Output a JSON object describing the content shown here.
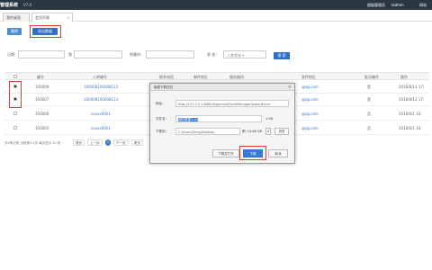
{
  "topbar": {
    "title": "管理系统",
    "version": "V7.0",
    "user1": "超级管理员",
    "user2": "ladmin",
    "user3": "网站"
  },
  "tabs": [
    {
      "label": "我的桌面"
    },
    {
      "label": "会员列表"
    }
  ],
  "toolbar": {
    "delete_label": "删除",
    "export_label": "导出数据"
  },
  "filter": {
    "label_date": "日期：",
    "label_to": "到",
    "label_city": "所属市：",
    "label_status": "状 态：",
    "status_value": "入库状态",
    "search_label": "搜 索"
  },
  "table": {
    "headers": [
      "编号",
      "入库编号",
      "联系电话",
      "邮件地址",
      "服务器码",
      "发件地址",
      "批次编号",
      "操作"
    ],
    "rows": [
      {
        "id": "100008",
        "code": "100008100008123",
        "email": "@qq.com",
        "op": "是",
        "date": "2016/8/12 17:"
      },
      {
        "id": "100007",
        "code": "100008100008123",
        "email": "@qq.com",
        "op": "是",
        "date": "2016/8/12 17:"
      },
      {
        "id": "100006",
        "code": "xxxxx0001",
        "email": "@qq.com",
        "op": "否",
        "date": "2016/6/1 10:"
      },
      {
        "id": "100005",
        "code": "xxxxx0001",
        "email": "@qq.com",
        "op": "否",
        "date": "2016/6/1 10:"
      }
    ]
  },
  "pager": {
    "info": "共4条记录 当前第1/1页 每页显示 10 条",
    "first": "首页",
    "prev": "上一页",
    "current": "1",
    "next": "下一页",
    "last": "尾页"
  },
  "dialog": {
    "title": "新建下载任务",
    "url_label": "网址：",
    "url_value": "http://127.0.0.1:8080/lhgdemo/EventManager/exportExcel",
    "filename_label": "文件名：",
    "filename_value": "我的数据1.xls",
    "filesize": "1 KB",
    "saveto_label": "下载到：",
    "saveto_value": "C:\\Users\\Zeng\\Desktop",
    "free_space": "剩: 14.86 GB",
    "browse_label": "浏览",
    "btn_open": "下载并打开",
    "btn_download": "下载",
    "btn_cancel": "取消"
  }
}
